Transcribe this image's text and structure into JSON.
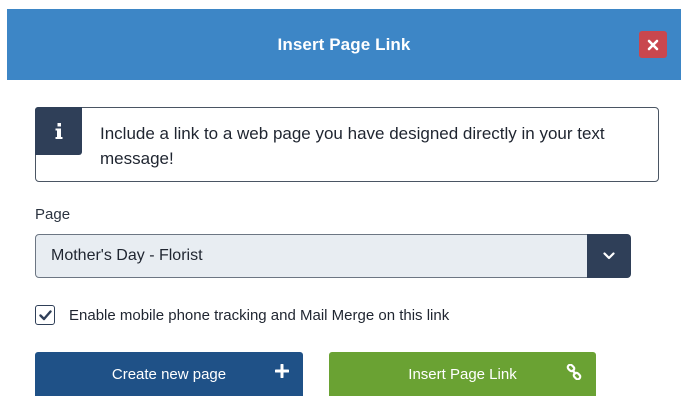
{
  "modal": {
    "title": "Insert Page Link",
    "close_icon": "close-icon"
  },
  "info": {
    "icon": "info-icon",
    "text": "Include a link to a web page you have designed directly in your text message!"
  },
  "page_field": {
    "label": "Page",
    "selected_value": "Mother's Day - Florist",
    "arrow_icon": "chevron-down-icon"
  },
  "tracking": {
    "checked": true,
    "label": "Enable mobile phone tracking and Mail Merge on this link"
  },
  "buttons": {
    "create_label": "Create new page",
    "create_icon": "plus-icon",
    "insert_label": "Insert Page Link",
    "insert_icon": "link-icon"
  },
  "colors": {
    "header": "#3d86c6",
    "close": "#c9474e",
    "dark_navy": "#2f3f58",
    "create_button": "#1f5187",
    "insert_button": "#6aa233"
  }
}
